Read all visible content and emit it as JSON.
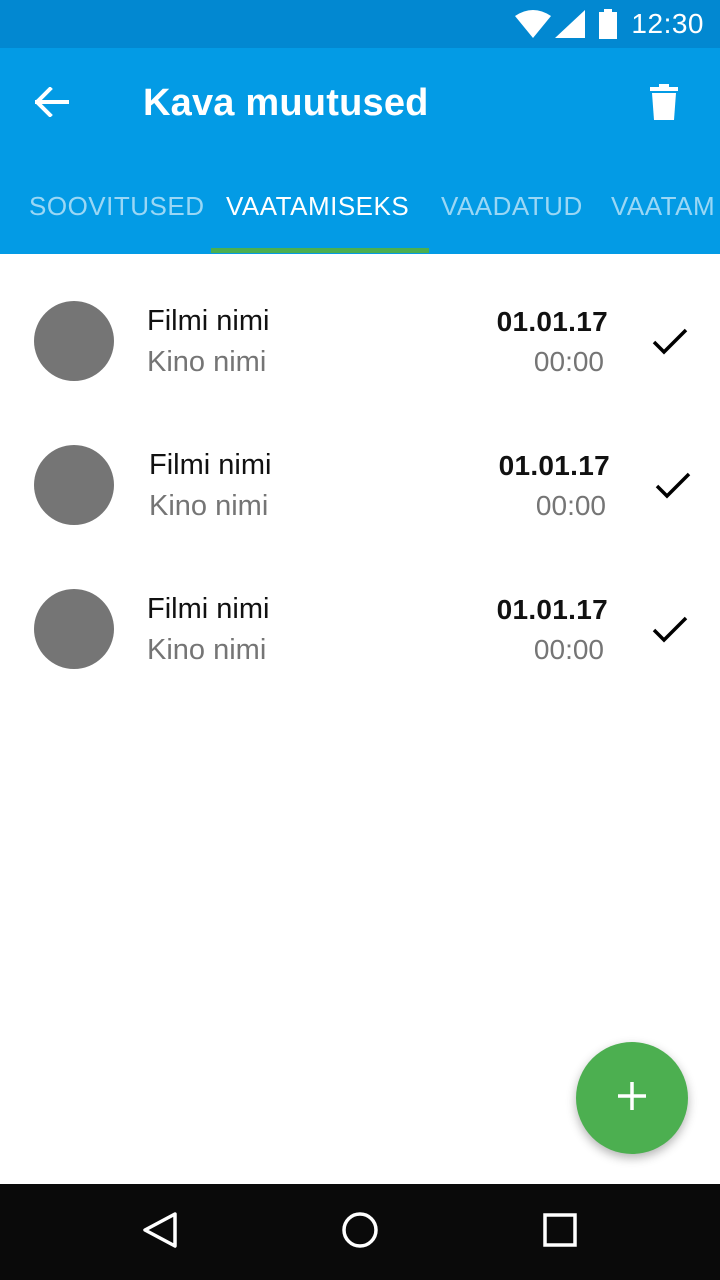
{
  "status_bar": {
    "time": "12:30",
    "icons": [
      "wifi-icon",
      "signal-icon",
      "battery-icon"
    ]
  },
  "app_bar": {
    "title": "Kava muutused",
    "back_icon": "arrow-back-icon",
    "delete_icon": "trash-icon",
    "color": "#039be5"
  },
  "tabs": [
    {
      "label": "SOOVITUSED",
      "active": false
    },
    {
      "label": "VAATAMISEKS",
      "active": true
    },
    {
      "label": "VAADATUD",
      "active": false
    },
    {
      "label": "VAATAM",
      "active": false
    }
  ],
  "items": [
    {
      "title": "Filmi nimi",
      "subtitle": "Kino nimi",
      "date": "01.01.17",
      "time": "00:00"
    },
    {
      "title": "Filmi nimi",
      "subtitle": "Kino nimi",
      "date": "01.01.17",
      "time": "00:00"
    },
    {
      "title": "Filmi nimi",
      "subtitle": "Kino nimi",
      "date": "01.01.17",
      "time": "00:00"
    }
  ],
  "fab": {
    "icon": "plus-icon",
    "color": "#4caf50"
  },
  "nav_bar": {
    "icons": [
      "back-triangle-icon",
      "home-circle-icon",
      "recents-square-icon"
    ]
  }
}
